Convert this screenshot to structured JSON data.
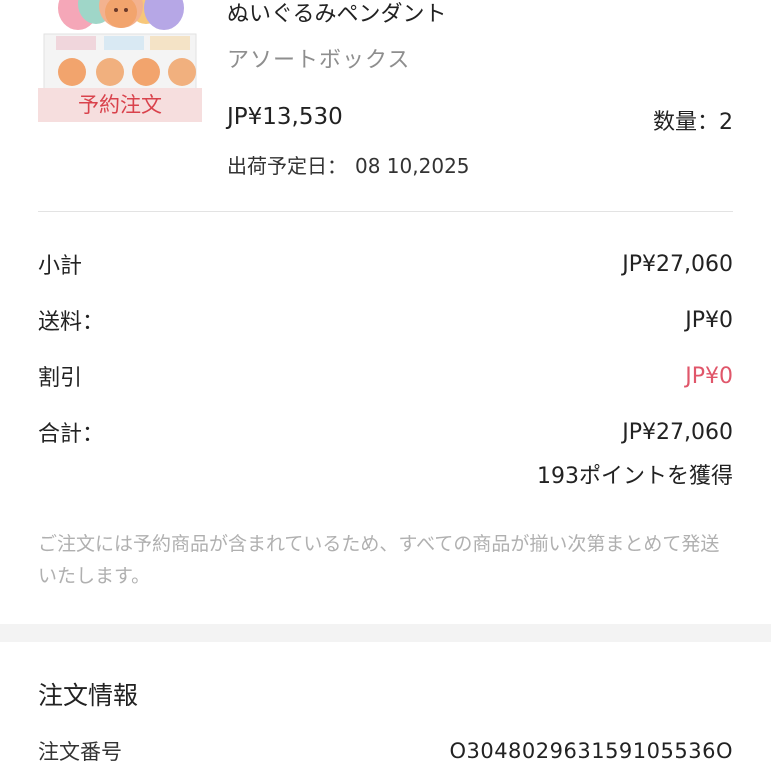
{
  "product": {
    "name": "ぬいぐるみペンダント",
    "variant": "アソートボックス",
    "badge": "予約注文",
    "price": "JP¥13,530",
    "quantity": "数量：2",
    "ship_label": "出荷予定日：",
    "ship_date": "08 10,2025"
  },
  "summary": {
    "subtotal_label": "小計",
    "subtotal_value": "JP¥27,060",
    "shipping_label": "送料：",
    "shipping_value": "JP¥0",
    "discount_label": "割引",
    "discount_value": "JP¥0",
    "total_label": "合計：",
    "total_value": "JP¥27,060",
    "points": "193ポイントを獲得"
  },
  "note": "ご注文には予約商品が含まれているため、すべての商品が揃い次第まとめて発送いたします。",
  "order_info": {
    "title": "注文情報",
    "number_label": "注文番号",
    "number_value": "O304802963159105536О"
  },
  "colors": {
    "discount": "#e0566a",
    "badge_text": "#d9424c",
    "badge_bg": "#f6dede",
    "note": "#b0b0b0"
  }
}
